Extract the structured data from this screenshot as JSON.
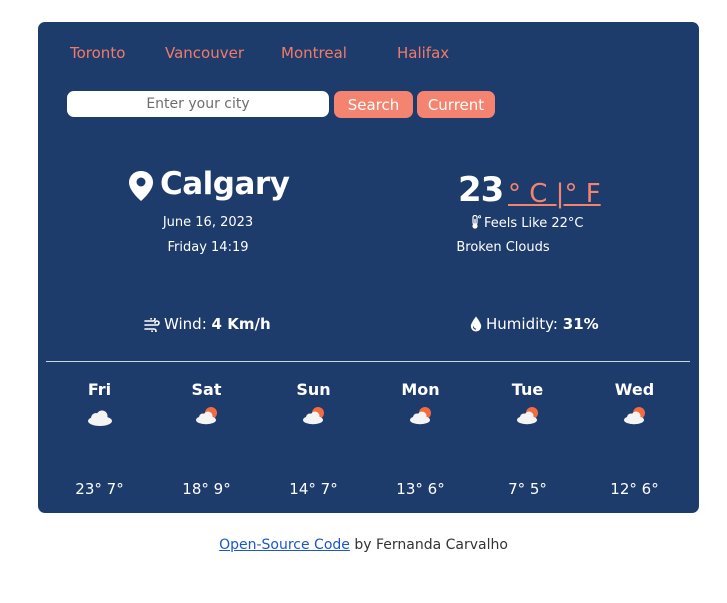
{
  "cities": [
    "Toronto",
    "Vancouver",
    "Montreal",
    "Halifax"
  ],
  "search": {
    "placeholder": "Enter your city",
    "search_label": "Search",
    "current_label": "Current"
  },
  "location": {
    "city": "Calgary",
    "date": "June 16, 2023",
    "time": "Friday 14:19"
  },
  "current": {
    "temperature": "23",
    "units": "° C |° F",
    "feels_like": "Feels Like 22°C",
    "description": "Broken Clouds",
    "wind_label": "Wind:",
    "wind_value": "4 Km/h",
    "humidity_label": "Humidity:",
    "humidity_value": "31%"
  },
  "forecast": [
    {
      "day": "Fri",
      "range": "23° 7°",
      "icon": "cloud-night-icon"
    },
    {
      "day": "Sat",
      "range": "18° 9°",
      "icon": "sun-cloud-icon"
    },
    {
      "day": "Sun",
      "range": "14° 7°",
      "icon": "sun-cloud-icon"
    },
    {
      "day": "Mon",
      "range": "13° 6°",
      "icon": "sun-cloud-icon"
    },
    {
      "day": "Tue",
      "range": "7° 5°",
      "icon": "sun-cloud-icon"
    },
    {
      "day": "Wed",
      "range": "12° 6°",
      "icon": "sun-cloud-icon"
    }
  ],
  "footer": {
    "link_text": "Open-Source Code",
    "suffix": " by Fernanda Carvalho"
  },
  "colors": {
    "card": "#1e3c6b",
    "accent": "#f4836f",
    "city_link": "#f07b6a"
  }
}
